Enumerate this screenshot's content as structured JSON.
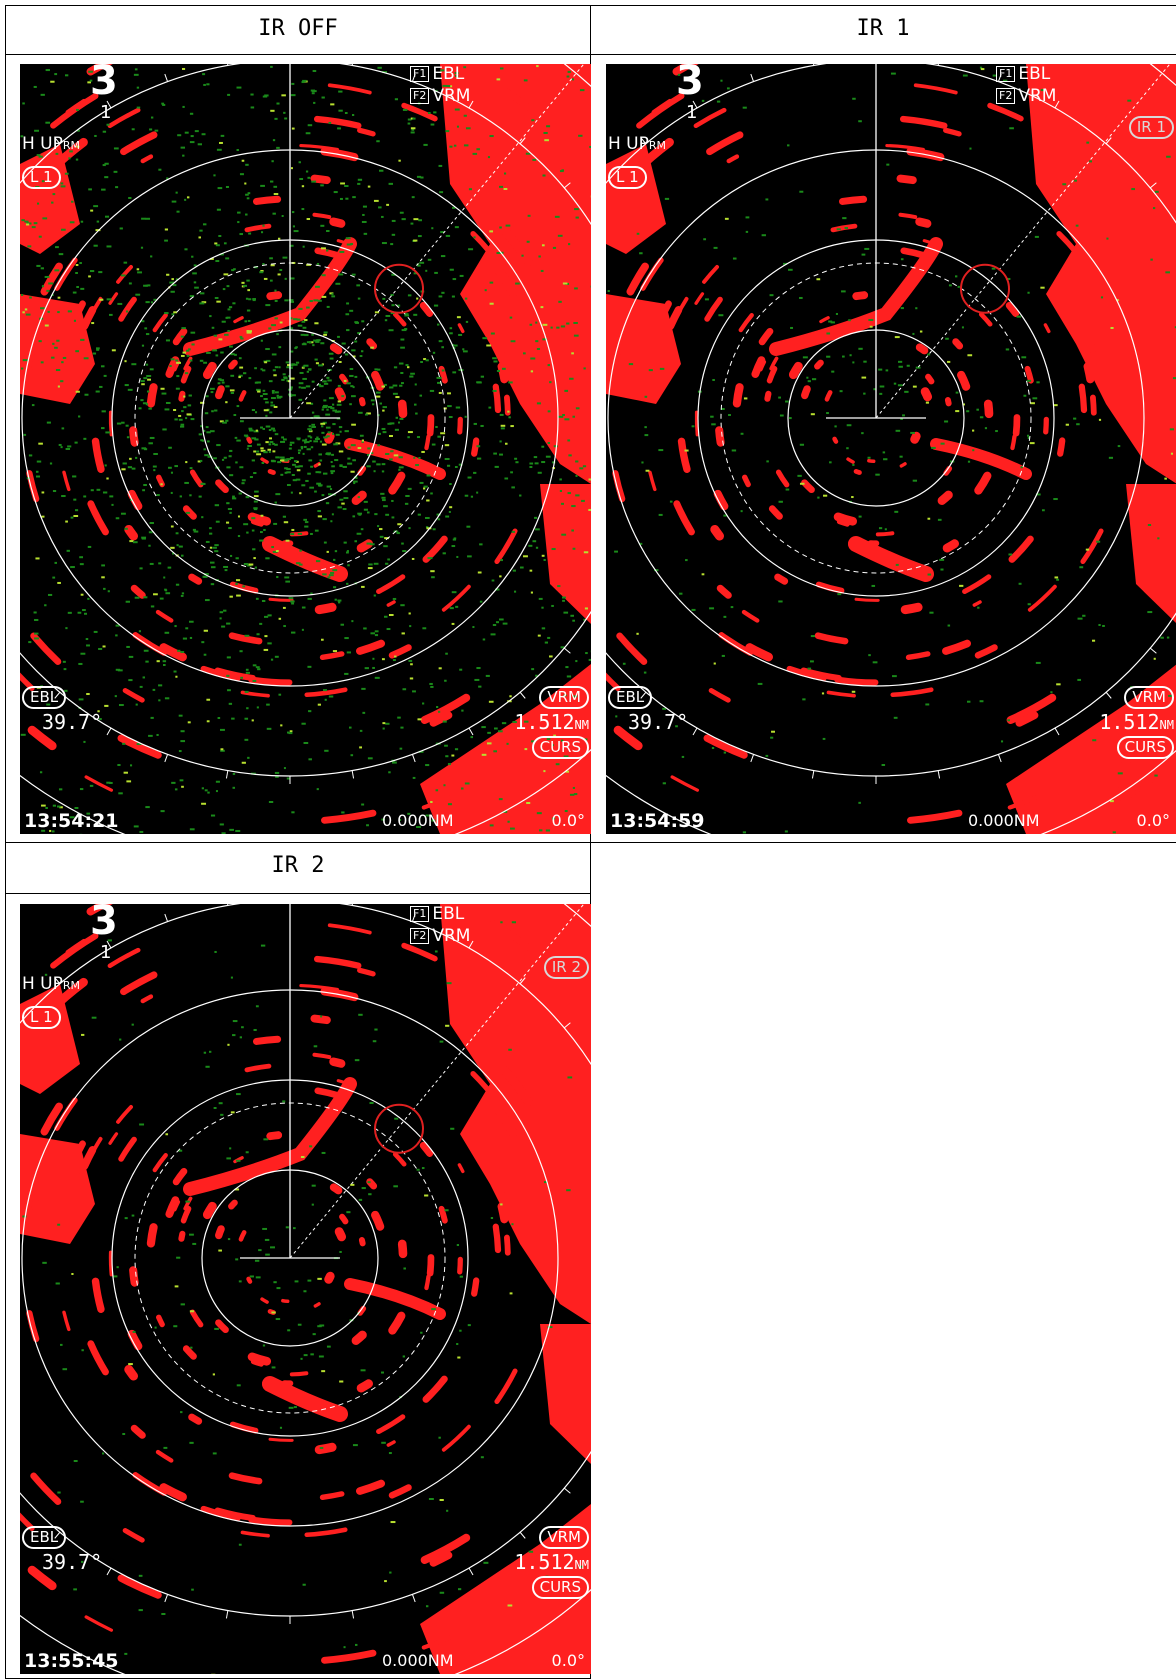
{
  "panels": [
    {
      "title": "IR OFF",
      "range": "3",
      "rings": "1",
      "mode": "H UP",
      "mode_sub": "RM",
      "level": "L 1",
      "ir_badge": "",
      "f1": "F1",
      "f1_label": "EBL",
      "f2": "F2",
      "f2_label": "VRM",
      "ebl_label": "EBL",
      "ebl_value": "39.7°",
      "vrm_label": "VRM",
      "vrm_value": "1.512",
      "vrm_unit": "NM",
      "curs_label": "CURS",
      "time": "13:54:21",
      "cursor_range": "0.000NM",
      "cursor_bearing": "0.0°",
      "noise": "high"
    },
    {
      "title": "IR 1",
      "range": "3",
      "rings": "1",
      "mode": "H UP",
      "mode_sub": "RM",
      "level": "L 1",
      "ir_badge": "IR 1",
      "f1": "F1",
      "f1_label": "EBL",
      "f2": "F2",
      "f2_label": "VRM",
      "ebl_label": "EBL",
      "ebl_value": "39.7°",
      "vrm_label": "VRM",
      "vrm_value": "1.512",
      "vrm_unit": "NM",
      "curs_label": "CURS",
      "time": "13:54:59",
      "cursor_range": "0.000NM",
      "cursor_bearing": "0.0°",
      "noise": "low"
    },
    {
      "title": "IR 2",
      "range": "3",
      "rings": "1",
      "mode": "H UP",
      "mode_sub": "RM",
      "level": "L 1",
      "ir_badge": "IR 2",
      "f1": "F1",
      "f1_label": "EBL",
      "f2": "F2",
      "f2_label": "VRM",
      "ebl_label": "EBL",
      "ebl_value": "39.7°",
      "vrm_label": "VRM",
      "vrm_value": "1.512",
      "vrm_unit": "NM",
      "curs_label": "CURS",
      "time": "13:55:45",
      "cursor_range": "0.000NM",
      "cursor_bearing": "0.0°",
      "noise": "lowest"
    }
  ],
  "colors": {
    "echo": "#ff2020",
    "noise": "#1a8a1a",
    "noise_bright": "#b8e030",
    "ring": "#ffffff",
    "target_circle": "#e02020"
  }
}
